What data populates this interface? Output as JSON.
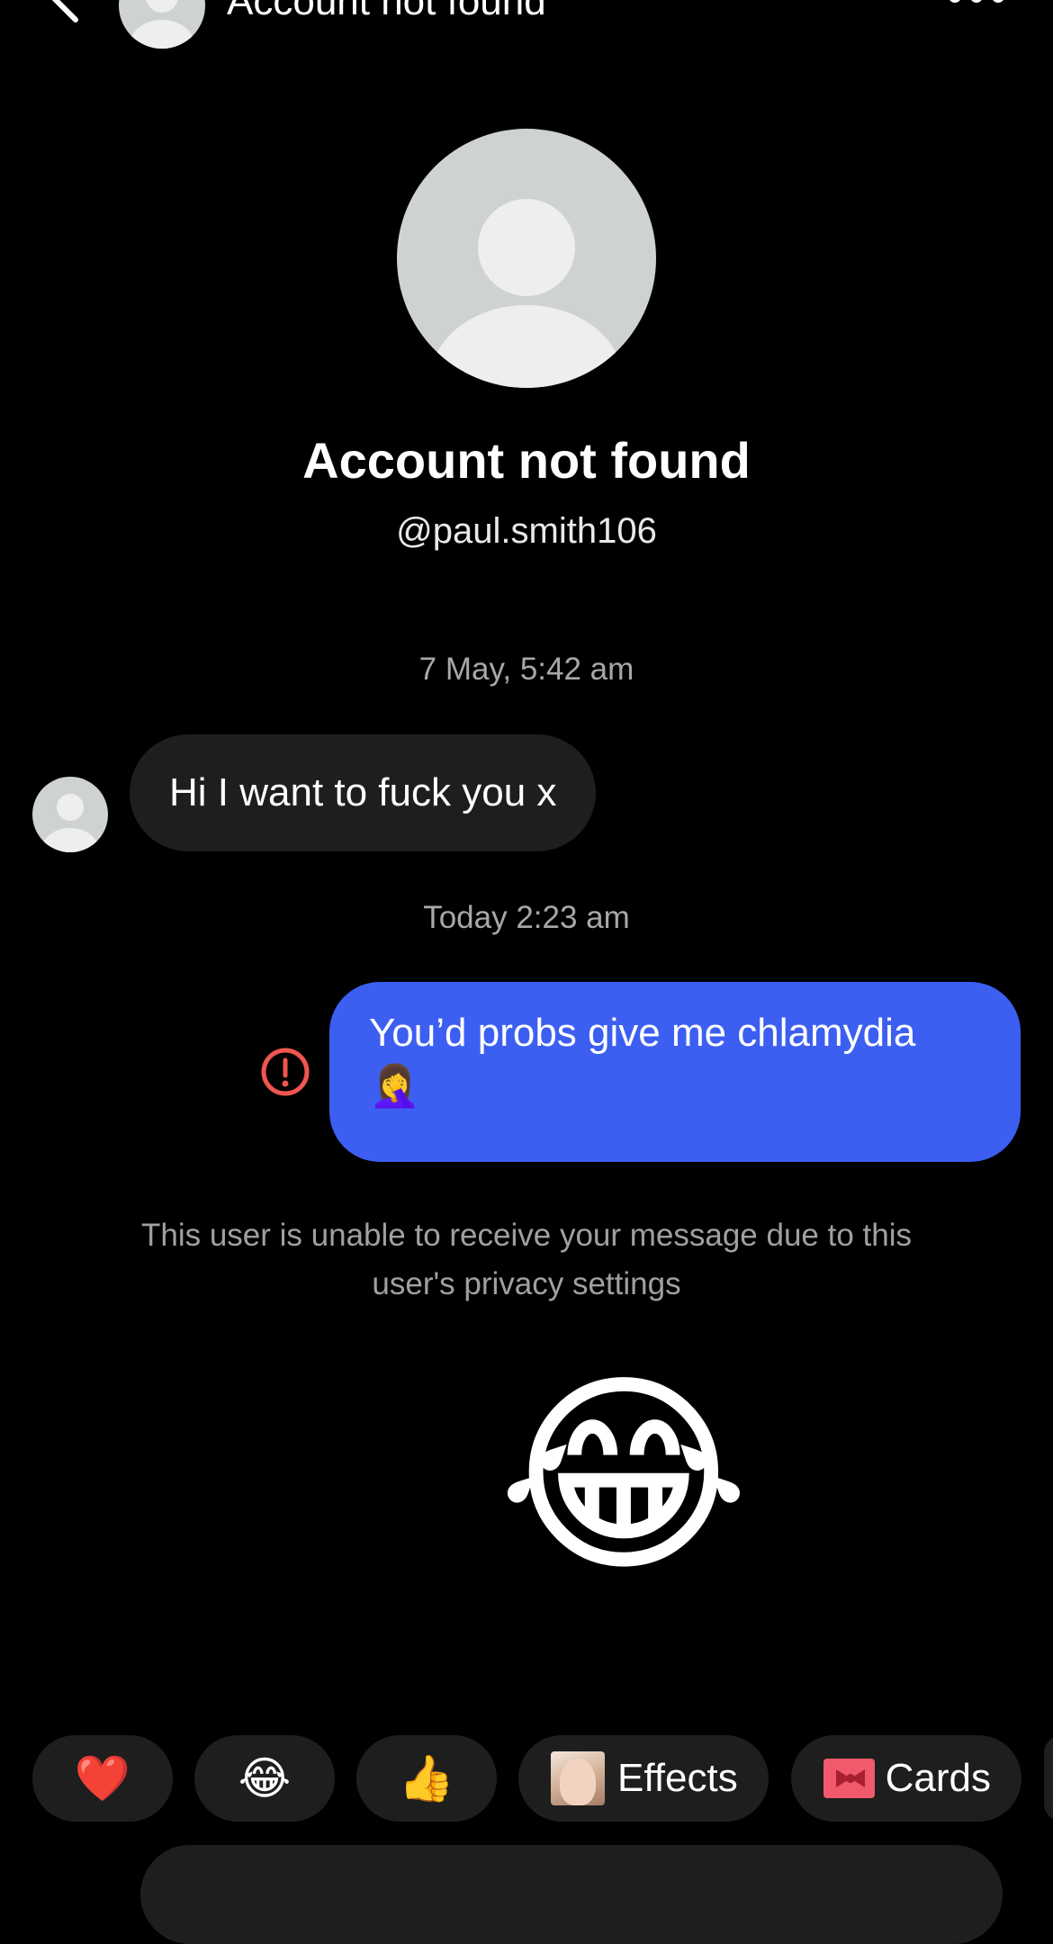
{
  "header": {
    "title": "Account not found",
    "back_icon": "chevron-left-icon",
    "more_icon": "more-horizontal-icon"
  },
  "profile": {
    "name": "Account not found",
    "handle": "@paul.smith106"
  },
  "conversation": {
    "timestamp_1": "7 May, 5:42 am",
    "incoming_message": "Hi I want to fuck you x",
    "timestamp_2": "Today 2:23 am",
    "outgoing_message_line1": "You’d probs give me chlamydia",
    "outgoing_message_line2": "🤦‍♀️",
    "error_icon": "alert-circle-icon",
    "privacy_note": "This user is unable to receive your message due to this user's privacy settings",
    "big_emoji": "😂"
  },
  "quick_replies": {
    "heart": "❤️",
    "joy": "😂",
    "thumbs_up": "👍",
    "effects_label": "Effects",
    "cards_label": "Cards"
  },
  "colors": {
    "background": "#000000",
    "outgoing_bubble": "#3c5ff2",
    "incoming_bubble": "#1e1e1e",
    "error": "#f0554f"
  }
}
